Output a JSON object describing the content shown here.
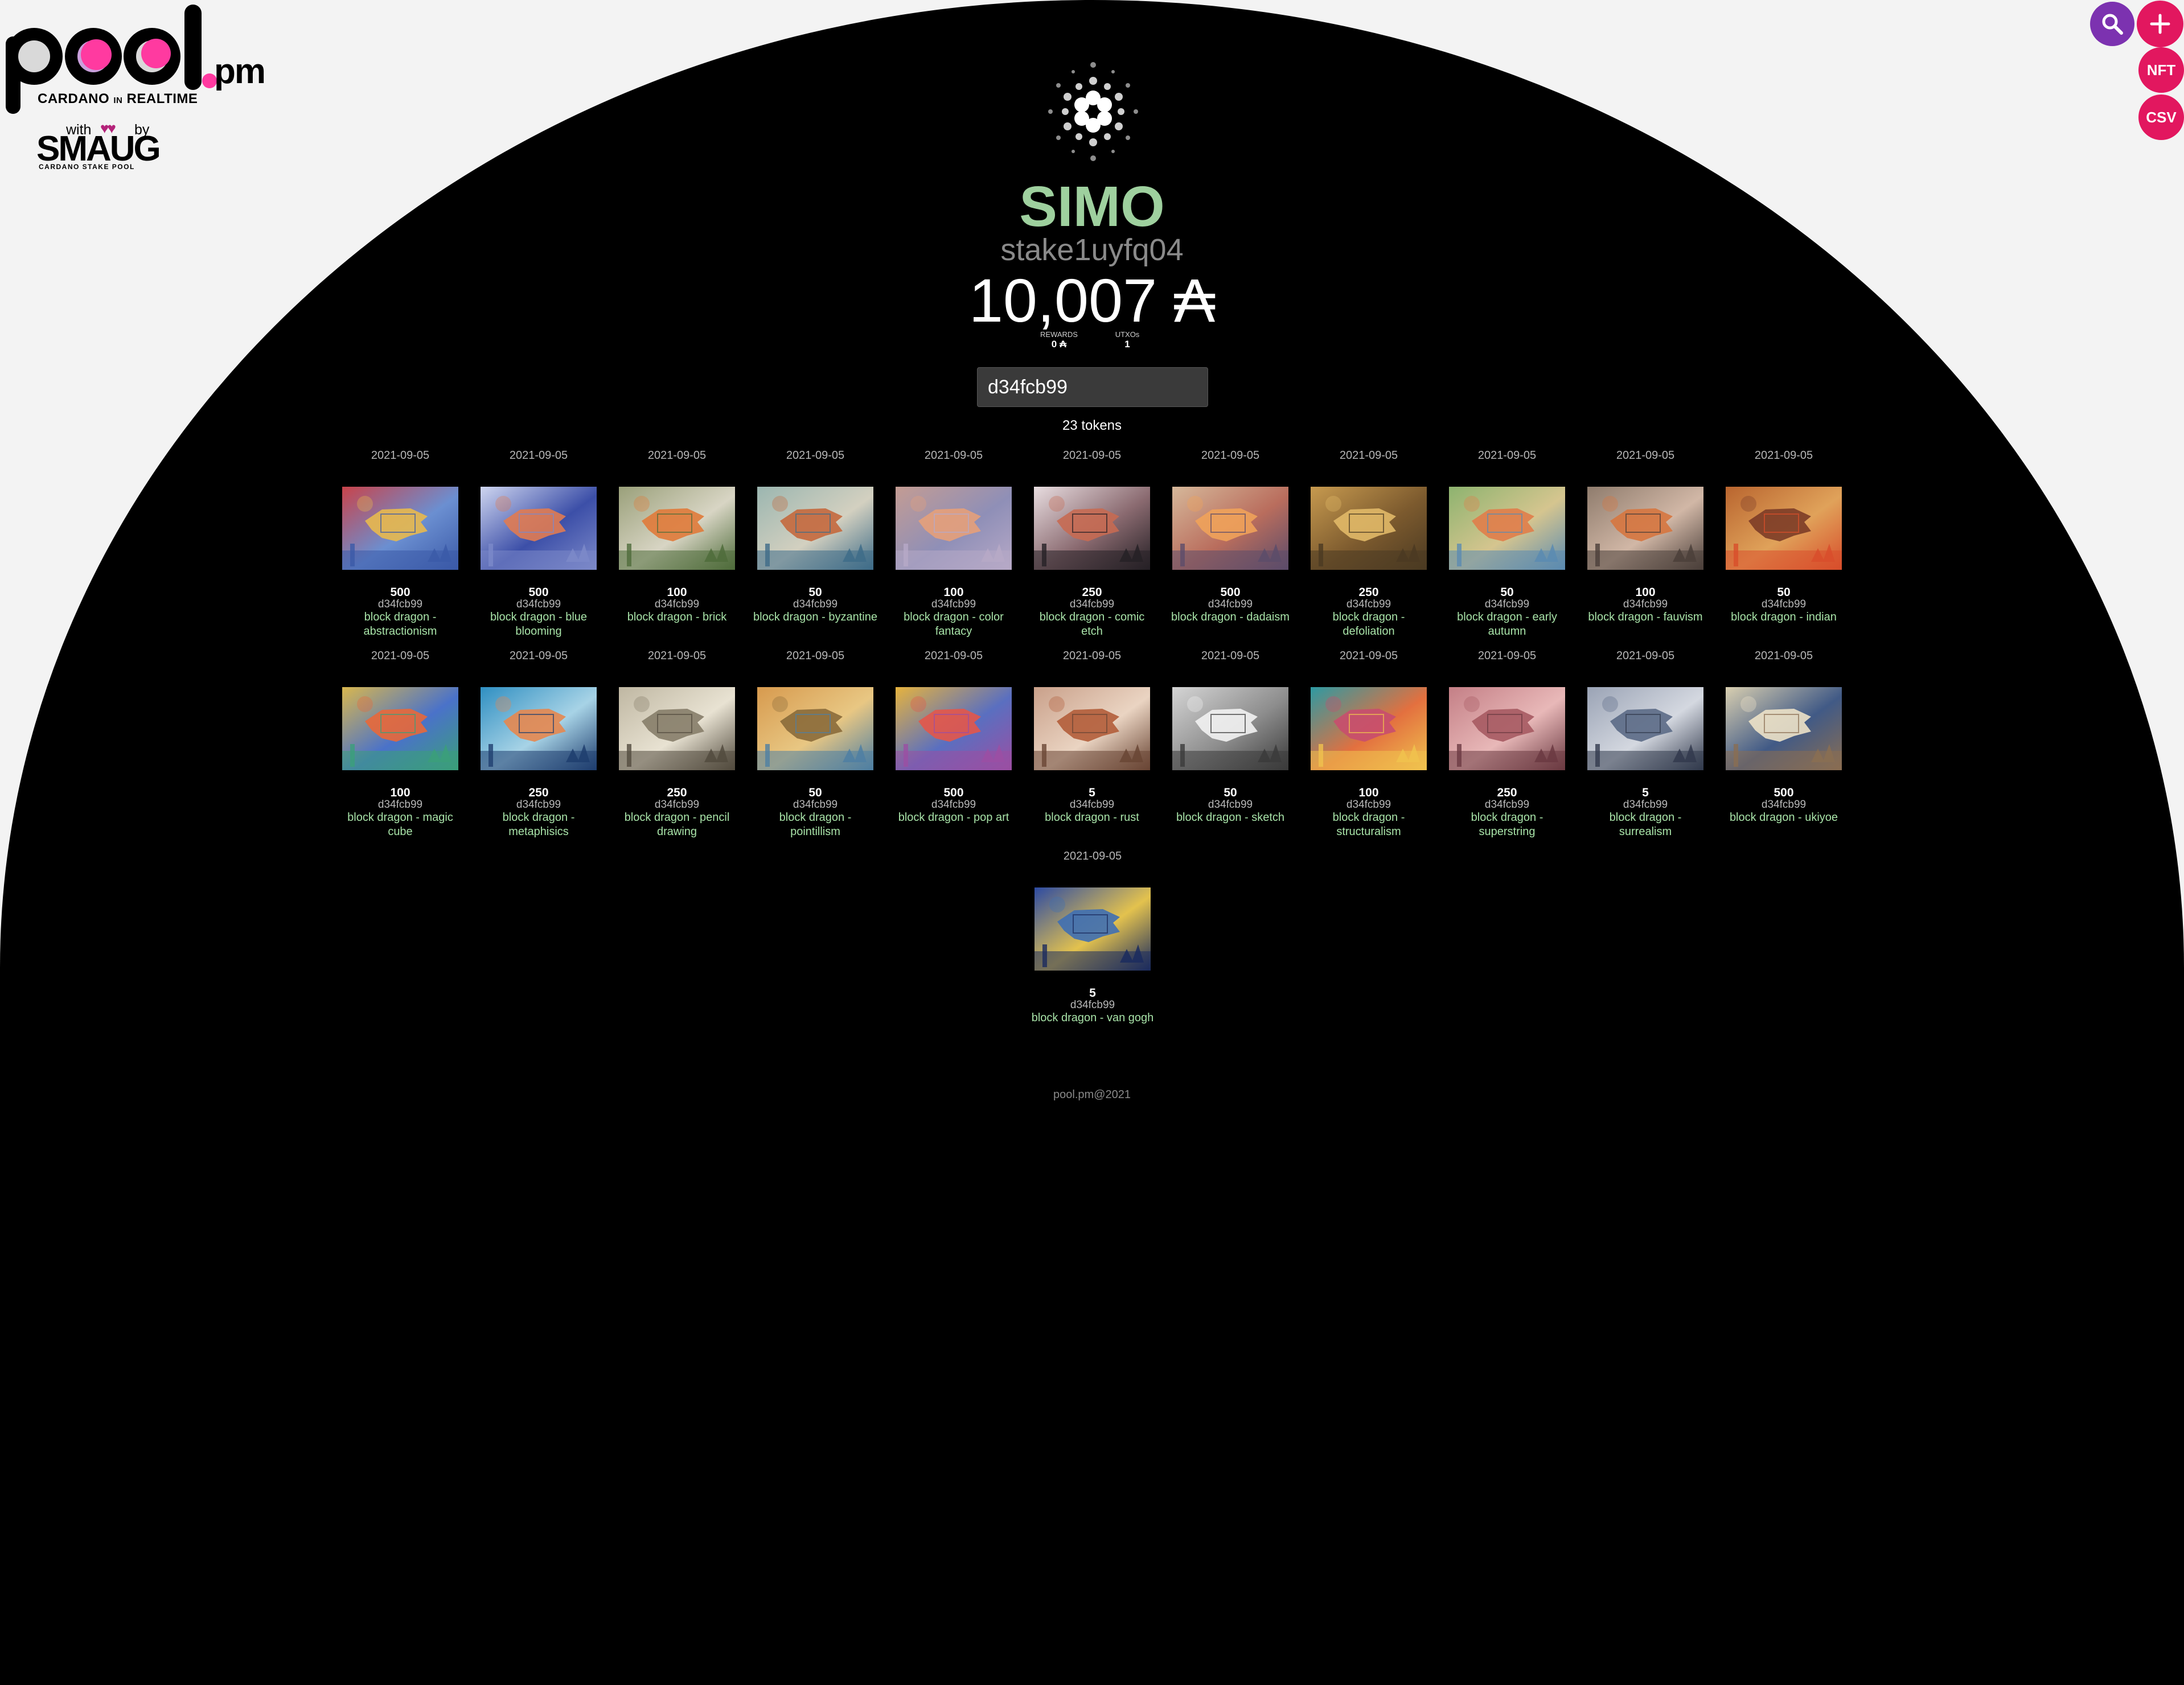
{
  "logo": {
    "brand": "pool.pm",
    "tagline_left": "CARDANO",
    "tagline_mid": "IN",
    "tagline_right": "REALTIME"
  },
  "credit": {
    "with": "with",
    "by": "by",
    "name": "SMAUG",
    "sub": "CARDANO STAKE POOL"
  },
  "actions": {
    "nft_label": "NFT",
    "csv_label": "CSV"
  },
  "wallet": {
    "name": "SIMO",
    "stake_address": "stake1uyfq04",
    "balance": "10,007 ₳",
    "rewards_label": "REWARDS",
    "rewards_value": "0 ₳",
    "utxos_label": "UTXOs",
    "utxos_value": "1"
  },
  "search": {
    "value": "d34fcb99"
  },
  "token_count": "23 tokens",
  "tokens": [
    {
      "date": "2021-09-05",
      "qty": "500",
      "policy": "d34fcb99",
      "name": "block dragon - abstractionism",
      "palette": [
        "#c9434a",
        "#6b8fd1",
        "#e8b94e",
        "#3b5aa8"
      ]
    },
    {
      "date": "2021-09-05",
      "qty": "500",
      "policy": "d34fcb99",
      "name": "block dragon - blue blooming",
      "palette": [
        "#cfd6f0",
        "#3c4fa8",
        "#e07b52",
        "#7c89c9"
      ]
    },
    {
      "date": "2021-09-05",
      "qty": "100",
      "policy": "d34fcb99",
      "name": "block dragon - brick",
      "palette": [
        "#9aa07a",
        "#d8d5c4",
        "#e07a3a",
        "#4f6c3b"
      ]
    },
    {
      "date": "2021-09-05",
      "qty": "50",
      "policy": "d34fcb99",
      "name": "block dragon - byzantine",
      "palette": [
        "#9bb6b0",
        "#d3d0c0",
        "#c4683d",
        "#3e6c88"
      ]
    },
    {
      "date": "2021-09-05",
      "qty": "100",
      "policy": "d34fcb99",
      "name": "block dragon - color fantacy",
      "palette": [
        "#c49c93",
        "#8f8fb7",
        "#e6a07a",
        "#b7a9c7"
      ]
    },
    {
      "date": "2021-09-05",
      "qty": "250",
      "policy": "d34fcb99",
      "name": "block dragon - comic etch",
      "palette": [
        "#e8dde0",
        "#8a6a70",
        "#c66a52",
        "#262126"
      ]
    },
    {
      "date": "2021-09-05",
      "qty": "500",
      "policy": "d34fcb99",
      "name": "block dragon - dadaism",
      "palette": [
        "#d6b89a",
        "#b96d5d",
        "#f0a25a",
        "#5c4c6a"
      ]
    },
    {
      "date": "2021-09-05",
      "qty": "250",
      "policy": "d34fcb99",
      "name": "block dragon - defoliation",
      "palette": [
        "#c79a4f",
        "#7c5a2e",
        "#e1b968",
        "#4b3a22"
      ]
    },
    {
      "date": "2021-09-05",
      "qty": "50",
      "policy": "d34fcb99",
      "name": "block dragon - early autumn",
      "palette": [
        "#8db36f",
        "#d5c58f",
        "#e07d4a",
        "#5b8bb1"
      ]
    },
    {
      "date": "2021-09-05",
      "qty": "100",
      "policy": "d34fcb99",
      "name": "block dragon - fauvism",
      "palette": [
        "#8f7c6d",
        "#d1b7a6",
        "#d6763f",
        "#4b3f3a"
      ]
    },
    {
      "date": "2021-09-05",
      "qty": "50",
      "policy": "d34fcb99",
      "name": "block dragon - indian",
      "palette": [
        "#b9652f",
        "#e0a25a",
        "#7c3c27",
        "#d84e2b"
      ]
    },
    {
      "date": "2021-09-05",
      "qty": "100",
      "policy": "d34fcb99",
      "name": "block dragon - magic cube",
      "palette": [
        "#d9b74e",
        "#4a72c9",
        "#e8683a",
        "#3b9f7a"
      ]
    },
    {
      "date": "2021-09-05",
      "qty": "250",
      "policy": "d34fcb99",
      "name": "block dragon - metaphisics",
      "palette": [
        "#2f8fc2",
        "#a7d3e6",
        "#e5874f",
        "#1f3e6f"
      ]
    },
    {
      "date": "2021-09-05",
      "qty": "250",
      "policy": "d34fcb99",
      "name": "block dragon - pencil drawing",
      "palette": [
        "#bfb7a2",
        "#e8e2d2",
        "#867d69",
        "#524b3e"
      ]
    },
    {
      "date": "2021-09-05",
      "qty": "50",
      "policy": "d34fcb99",
      "name": "block dragon - pointillism",
      "palette": [
        "#d79a4e",
        "#e8c783",
        "#8a6a3a",
        "#4f7fa3"
      ]
    },
    {
      "date": "2021-09-05",
      "qty": "500",
      "policy": "d34fcb99",
      "name": "block dragon - pop art",
      "palette": [
        "#e6b33e",
        "#5a6fc0",
        "#e3564a",
        "#9b4fa3"
      ]
    },
    {
      "date": "2021-09-05",
      "qty": "5",
      "policy": "d34fcb99",
      "name": "block dragon - rust",
      "palette": [
        "#c9a08a",
        "#ead4c2",
        "#b35d3a",
        "#6a4635"
      ]
    },
    {
      "date": "2021-09-05",
      "qty": "50",
      "policy": "d34fcb99",
      "name": "block dragon - sketch",
      "palette": [
        "#d5d5d5",
        "#8d8d8d",
        "#f2f2f2",
        "#3b3b3b"
      ]
    },
    {
      "date": "2021-09-05",
      "qty": "100",
      "policy": "d34fcb99",
      "name": "block dragon - structuralism",
      "palette": [
        "#2d9aa3",
        "#e3703f",
        "#c84e6e",
        "#f0c24e"
      ]
    },
    {
      "date": "2021-09-05",
      "qty": "250",
      "policy": "d34fcb99",
      "name": "block dragon - superstring",
      "palette": [
        "#c47f86",
        "#e8b8b8",
        "#a65a62",
        "#6b3a42"
      ]
    },
    {
      "date": "2021-09-05",
      "qty": "5",
      "policy": "d34fcb99",
      "name": "block dragon - surrealism",
      "palette": [
        "#9aa3b5",
        "#d4d8e0",
        "#5b6a86",
        "#323a4d"
      ]
    },
    {
      "date": "2021-09-05",
      "qty": "500",
      "policy": "d34fcb99",
      "name": "block dragon - ukiyoe",
      "palette": [
        "#d9cfb0",
        "#415a86",
        "#ede2c8",
        "#8a6e52"
      ]
    },
    {
      "date": "2021-09-05",
      "qty": "5",
      "policy": "d34fcb99",
      "name": "block dragon - van gogh",
      "palette": [
        "#2c4aa3",
        "#e3c24e",
        "#3f6fb3",
        "#1b2b5e"
      ]
    }
  ],
  "footer": "pool.pm@2021"
}
